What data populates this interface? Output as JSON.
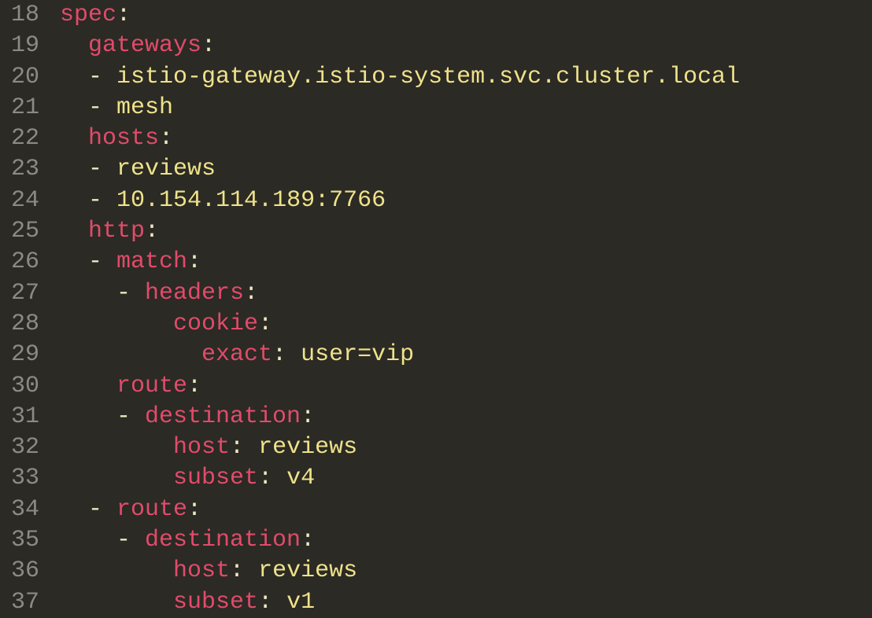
{
  "gutter": {
    "start": 18,
    "end": 37
  },
  "code": {
    "lines": [
      {
        "num": 18,
        "tokens": [
          {
            "t": "key",
            "v": "spec"
          },
          {
            "t": "punct",
            "v": ":"
          }
        ]
      },
      {
        "num": 19,
        "tokens": [
          {
            "t": "sp",
            "v": "  "
          },
          {
            "t": "key",
            "v": "gateways"
          },
          {
            "t": "punct",
            "v": ":"
          }
        ]
      },
      {
        "num": 20,
        "tokens": [
          {
            "t": "sp",
            "v": "  "
          },
          {
            "t": "dash",
            "v": "- "
          },
          {
            "t": "str",
            "v": "istio-gateway.istio-system.svc.cluster.local"
          }
        ]
      },
      {
        "num": 21,
        "tokens": [
          {
            "t": "sp",
            "v": "  "
          },
          {
            "t": "dash",
            "v": "- "
          },
          {
            "t": "str",
            "v": "mesh"
          }
        ]
      },
      {
        "num": 22,
        "tokens": [
          {
            "t": "sp",
            "v": "  "
          },
          {
            "t": "key",
            "v": "hosts"
          },
          {
            "t": "punct",
            "v": ":"
          }
        ]
      },
      {
        "num": 23,
        "tokens": [
          {
            "t": "sp",
            "v": "  "
          },
          {
            "t": "dash",
            "v": "- "
          },
          {
            "t": "str",
            "v": "reviews"
          }
        ]
      },
      {
        "num": 24,
        "tokens": [
          {
            "t": "sp",
            "v": "  "
          },
          {
            "t": "dash",
            "v": "- "
          },
          {
            "t": "str",
            "v": "10.154.114.189:7766"
          }
        ]
      },
      {
        "num": 25,
        "tokens": [
          {
            "t": "sp",
            "v": "  "
          },
          {
            "t": "key",
            "v": "http"
          },
          {
            "t": "punct",
            "v": ":"
          }
        ]
      },
      {
        "num": 26,
        "tokens": [
          {
            "t": "sp",
            "v": "  "
          },
          {
            "t": "dash",
            "v": "- "
          },
          {
            "t": "key",
            "v": "match"
          },
          {
            "t": "punct",
            "v": ":"
          }
        ]
      },
      {
        "num": 27,
        "tokens": [
          {
            "t": "sp",
            "v": "    "
          },
          {
            "t": "dash",
            "v": "- "
          },
          {
            "t": "key",
            "v": "headers"
          },
          {
            "t": "punct",
            "v": ":"
          }
        ]
      },
      {
        "num": 28,
        "tokens": [
          {
            "t": "sp",
            "v": "        "
          },
          {
            "t": "key",
            "v": "cookie"
          },
          {
            "t": "punct",
            "v": ":"
          }
        ]
      },
      {
        "num": 29,
        "tokens": [
          {
            "t": "sp",
            "v": "          "
          },
          {
            "t": "key",
            "v": "exact"
          },
          {
            "t": "punct",
            "v": ": "
          },
          {
            "t": "str",
            "v": "user=vip"
          }
        ]
      },
      {
        "num": 30,
        "tokens": [
          {
            "t": "sp",
            "v": "    "
          },
          {
            "t": "key",
            "v": "route"
          },
          {
            "t": "punct",
            "v": ":"
          }
        ]
      },
      {
        "num": 31,
        "tokens": [
          {
            "t": "sp",
            "v": "    "
          },
          {
            "t": "dash",
            "v": "- "
          },
          {
            "t": "key",
            "v": "destination"
          },
          {
            "t": "punct",
            "v": ":"
          }
        ]
      },
      {
        "num": 32,
        "tokens": [
          {
            "t": "sp",
            "v": "        "
          },
          {
            "t": "key",
            "v": "host"
          },
          {
            "t": "punct",
            "v": ": "
          },
          {
            "t": "str",
            "v": "reviews"
          }
        ]
      },
      {
        "num": 33,
        "tokens": [
          {
            "t": "sp",
            "v": "        "
          },
          {
            "t": "key",
            "v": "subset"
          },
          {
            "t": "punct",
            "v": ": "
          },
          {
            "t": "str",
            "v": "v4"
          }
        ]
      },
      {
        "num": 34,
        "tokens": [
          {
            "t": "sp",
            "v": "  "
          },
          {
            "t": "dash",
            "v": "- "
          },
          {
            "t": "key",
            "v": "route"
          },
          {
            "t": "punct",
            "v": ":"
          }
        ]
      },
      {
        "num": 35,
        "tokens": [
          {
            "t": "sp",
            "v": "    "
          },
          {
            "t": "dash",
            "v": "- "
          },
          {
            "t": "key",
            "v": "destination"
          },
          {
            "t": "punct",
            "v": ":"
          }
        ]
      },
      {
        "num": 36,
        "tokens": [
          {
            "t": "sp",
            "v": "        "
          },
          {
            "t": "key",
            "v": "host"
          },
          {
            "t": "punct",
            "v": ": "
          },
          {
            "t": "str",
            "v": "reviews"
          }
        ]
      },
      {
        "num": 37,
        "tokens": [
          {
            "t": "sp",
            "v": "        "
          },
          {
            "t": "key",
            "v": "subset"
          },
          {
            "t": "punct",
            "v": ": "
          },
          {
            "t": "str",
            "v": "v1"
          }
        ]
      }
    ]
  }
}
